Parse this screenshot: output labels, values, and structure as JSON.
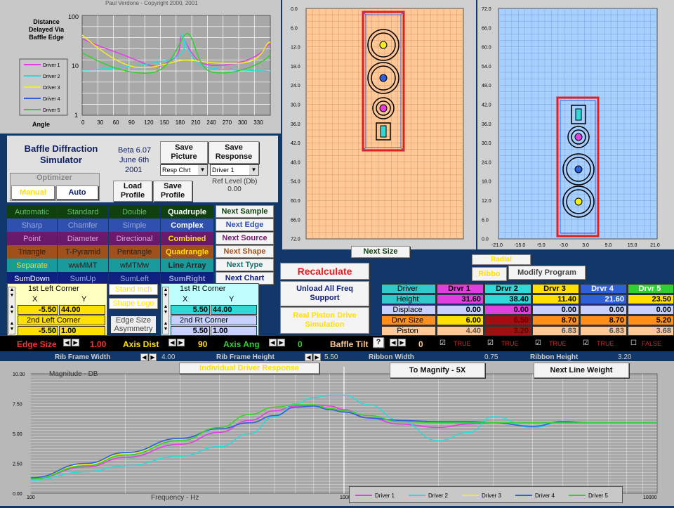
{
  "copyright": "Paul Verdone - Copyright 2000, 2001",
  "delay_chart": {
    "title": "Distance Delayed Via Baffle Edge",
    "y_ticks": [
      "100",
      "10",
      "1"
    ],
    "x_ticks": [
      "0",
      "30",
      "60",
      "90",
      "120",
      "150",
      "180",
      "210",
      "240",
      "270",
      "300",
      "330"
    ],
    "xlabel": "Angle",
    "legend": [
      "Driver 1",
      "Driver 2",
      "Driver 3",
      "Driver 4",
      "Driver 5"
    ]
  },
  "app": {
    "title": "Baffle Diffraction Simulator",
    "version": "Beta 6.07",
    "date": "June 6th",
    "year": "2001"
  },
  "buttons": {
    "save_picture": "Save Picture",
    "save_response": "Save Response",
    "load_profile": "Load Profile",
    "save_profile": "Save Profile",
    "recalculate": "Recalculate",
    "unload": "Unload All Freq Support",
    "real_piston": "Real Piston Drive Simulation",
    "next_size": "Next Size",
    "modify": "Modify Program",
    "magnify": "To Magnify - 5X",
    "next_line": "Next Line Weight",
    "radial": "Radial",
    "ribbon": "Ribbo"
  },
  "selects": {
    "resp": "Resp Chrt",
    "driver": "Driver 1"
  },
  "ref_level": {
    "label": "Ref Level (Db)",
    "value": "0.00"
  },
  "optimizer": {
    "title": "Optimizer",
    "manual": "Manual",
    "auto": "Auto"
  },
  "modes": {
    "r1": [
      "Automatic",
      "Standard",
      "Double",
      "Quadruple"
    ],
    "r2": [
      "Sharp",
      "Chamfer",
      "Simple",
      "Complex"
    ],
    "r3": [
      "Point",
      "Diameter",
      "Directional",
      "Combined"
    ],
    "r4": [
      "Triangle",
      "T-Pyramid",
      "Pentangle",
      "Quadrangle"
    ],
    "r5": [
      "Separate",
      "wwMMT",
      "wMTMw",
      "Line Array"
    ],
    "r6": [
      "SumDown",
      "SumUp",
      "SumLeft",
      "SumRight"
    ]
  },
  "next_buttons": [
    "Next Sample",
    "Next Edge",
    "Next Source",
    "Next Shape",
    "Next Type",
    "Next Chart"
  ],
  "corners": {
    "l1": "1st Left Corner",
    "l2": "2nd Left Corner",
    "r1": "1st Rt Corner",
    "r2": "2nd Rt Corner",
    "x": "X",
    "y": "Y",
    "l1x": "-5.50",
    "l1y": "44.00",
    "l2x": "-5.50",
    "l2y": "1.00",
    "r1x": "5.50",
    "r1y": "44.00",
    "r2x": "5.50",
    "r2y": "1.00",
    "stand_inch": "Stand Inch",
    "shape_logo": "Shape Logo",
    "edge_size_asym": "Edge Size Asymmetry"
  },
  "drivers_table": {
    "headers": [
      "Driver",
      "Drvr 1",
      "Drvr 2",
      "Drvr 3",
      "Drvr 4",
      "Drvr 5"
    ],
    "height": [
      "Height",
      "31.60",
      "38.40",
      "11.40",
      "21.60",
      "23.50"
    ],
    "displace": [
      "Displace",
      "0.00",
      "0.00",
      "0.00",
      "0.00",
      "0.00"
    ],
    "size": [
      "Drvr Size",
      "6.00",
      "6.50",
      "8.70",
      "8.70",
      "5.20"
    ],
    "piston": [
      "Piston",
      "4.40",
      "3.20",
      "6.83",
      "6.83",
      "3.68"
    ]
  },
  "controls": {
    "edge_size": "Edge Size",
    "edge_val": "1.00",
    "axis_dist": "Axis Dist",
    "axis_dist_val": "90",
    "axis_ang": "Axis Ang",
    "axis_ang_val": "0",
    "baffle_tilt": "Baffle Tilt",
    "tilt_val": "0",
    "q": "?",
    "t1": "TRUE",
    "t2": "TRUE",
    "t3": "TRUE",
    "t4": "TRUE",
    "f5": "FALSE",
    "rib_w": "Rib Frame Width",
    "rib_w_val": "4.00",
    "rib_h": "Rib Frame Height",
    "rib_h_val": "5.50",
    "ribbon_w": "Ribbon Width",
    "ribbon_w_val": "0.75",
    "ribbon_h": "Ribbon Height",
    "ribbon_h_val": "3.20"
  },
  "front_view": {
    "y_ticks": [
      "0.0",
      "6.0",
      "12.0",
      "18.0",
      "24.0",
      "30.0",
      "36.0",
      "42.0",
      "48.0",
      "54.0",
      "60.0",
      "66.0",
      "72.0"
    ]
  },
  "rear_view": {
    "y_ticks": [
      "72.0",
      "66.0",
      "60.0",
      "54.0",
      "48.0",
      "42.0",
      "36.0",
      "30.0",
      "24.0",
      "18.0",
      "12.0",
      "6.0",
      "0.0"
    ],
    "x_ticks": [
      "-21.0",
      "-15.0",
      "-9.0",
      "-3.0",
      "3.0",
      "9.0",
      "15.0",
      "21.0"
    ]
  },
  "response_chart": {
    "title": "Individual Driver Response",
    "ylabel": "Magnitude - DB",
    "xlabel": "Frequency - Hz",
    "y_ticks": [
      "10.00",
      "7.50",
      "5.00",
      "2.50",
      "0.00"
    ],
    "x_ticks": [
      "100",
      "1000",
      "10000"
    ],
    "legend": [
      "Driver 1",
      "Driver 2",
      "Driver 3",
      "Driver 4",
      "Driver 5"
    ]
  },
  "chart_data": {
    "type": "line",
    "title": "Individual Driver Response",
    "xlabel": "Frequency - Hz",
    "ylabel": "Magnitude - DB",
    "xscale": "log",
    "xlim": [
      100,
      10000
    ],
    "ylim": [
      0,
      10
    ],
    "x": [
      100,
      150,
      200,
      300,
      400,
      500,
      600,
      700,
      800,
      900,
      1000,
      1200,
      1500,
      2000,
      2500,
      3000,
      4000,
      5000,
      6000,
      8000,
      10000
    ],
    "series": [
      {
        "name": "Driver 1",
        "color": "#e040e0",
        "values": [
          1.2,
          2.2,
          3.0,
          4.1,
          5.1,
          6.1,
          6.9,
          7.3,
          7.4,
          7.3,
          7.0,
          6.3,
          5.8,
          5.5,
          5.8,
          5.9,
          5.9,
          5.9,
          5.9,
          5.9,
          5.9
        ]
      },
      {
        "name": "Driver 2",
        "color": "#30d8d8",
        "values": [
          1.1,
          1.8,
          2.3,
          3.1,
          3.9,
          5.0,
          6.4,
          7.5,
          8.0,
          8.2,
          8.2,
          7.4,
          6.1,
          4.4,
          5.1,
          6.4,
          5.5,
          6.0,
          5.9,
          5.9,
          5.9
        ]
      },
      {
        "name": "Driver 3",
        "color": "#f0f020",
        "values": [
          1.2,
          2.4,
          3.3,
          4.4,
          5.5,
          6.6,
          7.2,
          7.4,
          7.4,
          7.1,
          6.9,
          6.5,
          6.0,
          5.9,
          5.9,
          5.9,
          5.9,
          5.9,
          5.9,
          5.9,
          5.9
        ]
      },
      {
        "name": "Driver 4",
        "color": "#3060d8",
        "values": [
          1.3,
          2.5,
          3.4,
          4.6,
          5.4,
          5.9,
          6.5,
          7.2,
          7.3,
          7.0,
          6.8,
          6.3,
          6.1,
          6.0,
          6.0,
          5.9,
          5.6,
          6.0,
          5.9,
          5.9,
          5.9
        ]
      },
      {
        "name": "Driver 5",
        "color": "#30d030",
        "values": [
          1.2,
          2.3,
          3.2,
          4.4,
          5.5,
          6.6,
          7.2,
          7.4,
          7.4,
          7.1,
          6.9,
          6.5,
          6.0,
          5.9,
          5.9,
          5.9,
          5.9,
          5.9,
          5.9,
          5.9,
          5.9
        ]
      }
    ]
  }
}
